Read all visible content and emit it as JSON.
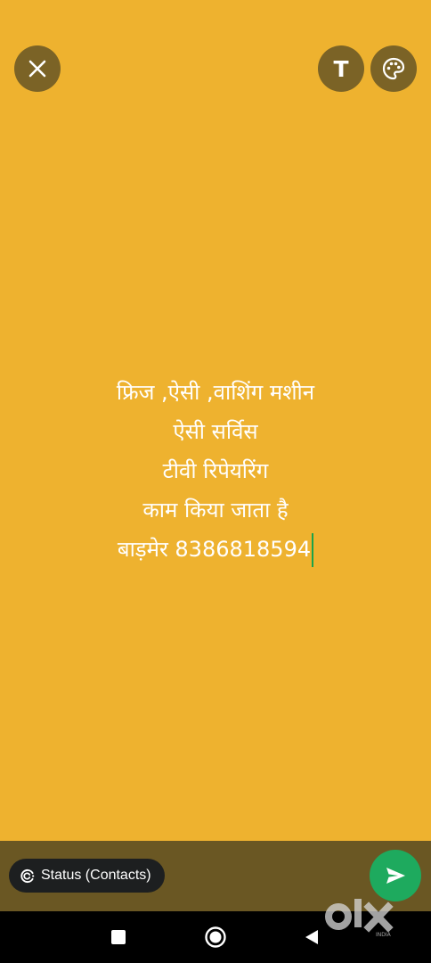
{
  "editor": {
    "background_color": "#eeb22f",
    "close_icon": "close-icon",
    "text_tool_label": "T",
    "palette_icon": "palette-icon",
    "lines": [
      "फ्रिज ,ऐसी ,वाशिंग मशीन",
      "ऐसी सर्विस",
      "टीवी रिपेयरिंग",
      "काम किया जाता है",
      "बाड़मेर 8386818594"
    ]
  },
  "bottom_bar": {
    "audience_label": "Status (Contacts)",
    "audience_icon": "status-icon",
    "send_icon": "send-icon",
    "send_color": "#1eaa5e"
  },
  "system_nav": {
    "recents_icon": "square-icon",
    "home_icon": "circle-icon",
    "back_icon": "triangle-back-icon"
  },
  "watermark": {
    "brand": "olx",
    "sub": "INDIA"
  }
}
